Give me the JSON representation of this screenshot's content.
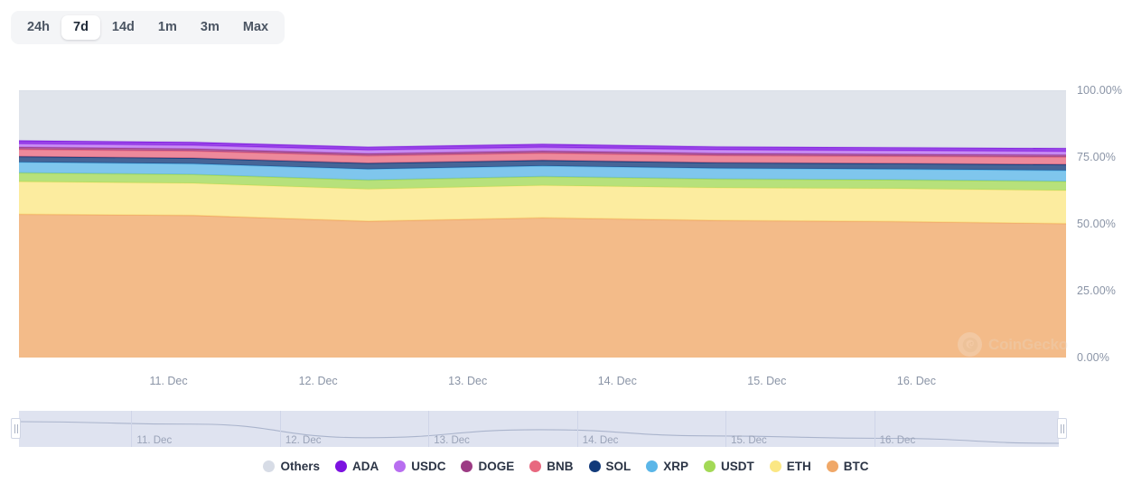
{
  "range_selector": {
    "options": [
      {
        "label": "24h",
        "active": false
      },
      {
        "label": "7d",
        "active": true
      },
      {
        "label": "14d",
        "active": false
      },
      {
        "label": "1m",
        "active": false
      },
      {
        "label": "3m",
        "active": false
      },
      {
        "label": "Max",
        "active": false
      }
    ]
  },
  "watermark": {
    "text": "CoinGecko",
    "logo_icon": "gecko-logo-icon"
  },
  "navigator": {
    "x_labels": [
      "11. Dec",
      "12. Dec",
      "13. Dec",
      "14. Dec",
      "15. Dec",
      "16. Dec"
    ],
    "left_handle_label": "navigator-left-handle",
    "right_handle_label": "navigator-right-handle"
  },
  "chart_data": {
    "type": "area",
    "title": "",
    "subtitle": "",
    "xlabel": "",
    "ylabel": "",
    "stacked": true,
    "percent_stacked": true,
    "grid": false,
    "legend_position": "bottom",
    "ylim": [
      0,
      100
    ],
    "y_ticks": [
      0,
      25,
      50,
      75,
      100
    ],
    "y_tick_labels": [
      "0.00%",
      "25.00%",
      "50.00%",
      "75.00%",
      "100.00%"
    ],
    "x": [
      "11. Dec",
      "12. Dec",
      "13. Dec",
      "14. Dec",
      "15. Dec",
      "16. Dec"
    ],
    "x_tick_labels": [
      "11. Dec",
      "12. Dec",
      "13. Dec",
      "14. Dec",
      "15. Dec",
      "16. Dec"
    ],
    "series": [
      {
        "name": "BTC",
        "color": "#f0a868",
        "values": [
          53.6,
          53.2,
          51.0,
          52.3,
          51.3,
          50.9,
          50.1
        ]
      },
      {
        "name": "ETH",
        "color": "#fbe784",
        "values": [
          12.2,
          12.0,
          12.0,
          12.1,
          12.2,
          12.3,
          12.4
        ]
      },
      {
        "name": "USDT",
        "color": "#a3d956",
        "values": [
          3.3,
          3.3,
          3.4,
          3.3,
          3.3,
          3.3,
          3.4
        ]
      },
      {
        "name": "XRP",
        "color": "#5bb6e8",
        "values": [
          4.0,
          4.0,
          4.1,
          4.0,
          4.0,
          4.0,
          4.1
        ]
      },
      {
        "name": "SOL",
        "color": "#123a7a",
        "values": [
          2.1,
          2.1,
          2.2,
          2.1,
          2.1,
          2.1,
          2.2
        ]
      },
      {
        "name": "BNB",
        "color": "#e8687f",
        "values": [
          2.7,
          2.7,
          2.8,
          2.7,
          2.7,
          2.7,
          2.8
        ]
      },
      {
        "name": "DOGE",
        "color": "#9c3b84",
        "values": [
          0.8,
          0.8,
          0.8,
          0.8,
          0.8,
          0.8,
          0.8
        ]
      },
      {
        "name": "USDC",
        "color": "#b86ef0",
        "values": [
          1.3,
          1.3,
          1.3,
          1.3,
          1.3,
          1.3,
          1.3
        ]
      },
      {
        "name": "ADA",
        "color": "#7c12e0",
        "values": [
          1.2,
          1.2,
          1.2,
          1.3,
          1.2,
          1.2,
          1.2
        ]
      },
      {
        "name": "Others",
        "color": "#d7dce6",
        "values": [
          18.8,
          19.4,
          21.2,
          20.1,
          21.1,
          21.4,
          21.7
        ]
      }
    ],
    "legend": [
      {
        "label": "Others",
        "color": "#d7dce6"
      },
      {
        "label": "ADA",
        "color": "#7c12e0"
      },
      {
        "label": "USDC",
        "color": "#b86ef0"
      },
      {
        "label": "DOGE",
        "color": "#9c3b84"
      },
      {
        "label": "BNB",
        "color": "#e8687f"
      },
      {
        "label": "SOL",
        "color": "#123a7a"
      },
      {
        "label": "XRP",
        "color": "#5bb6e8"
      },
      {
        "label": "USDT",
        "color": "#a3d956"
      },
      {
        "label": "ETH",
        "color": "#fbe784"
      },
      {
        "label": "BTC",
        "color": "#f0a868"
      }
    ]
  }
}
